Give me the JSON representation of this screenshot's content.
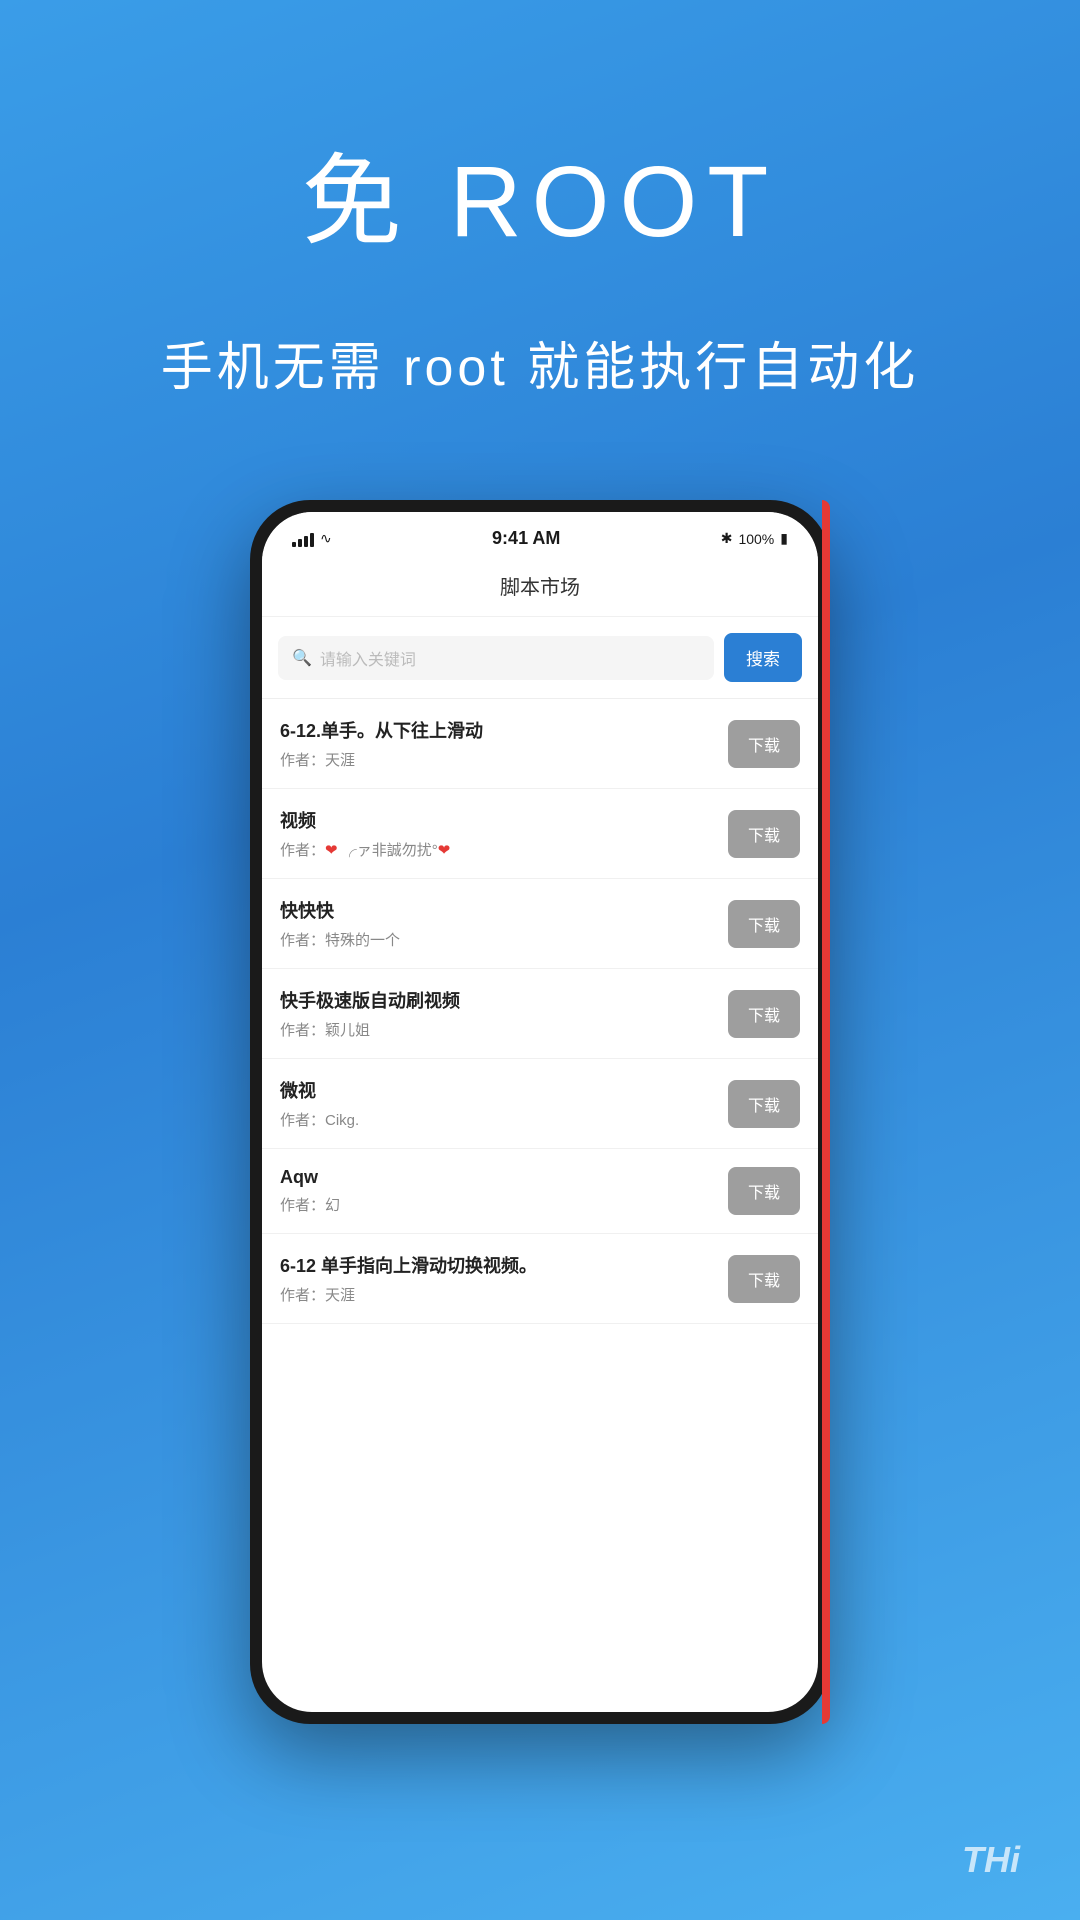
{
  "header": {
    "main_title": "免 ROOT",
    "sub_title": "手机无需 root 就能执行自动化"
  },
  "status_bar": {
    "time": "9:41 AM",
    "battery_percent": "100%",
    "bluetooth": "✱"
  },
  "app": {
    "title": "脚本市场",
    "search_placeholder": "请输入关键词",
    "search_button_label": "搜索"
  },
  "scripts": [
    {
      "name": "6-12.单手。从下往上滑动",
      "author": "作者：天涯",
      "download_label": "下载"
    },
    {
      "name": "视频",
      "author_prefix": "作者：",
      "author_special": "❤ ╭ァ非誠勿扰°❤",
      "download_label": "下载"
    },
    {
      "name": "快快快",
      "author": "作者：特殊的一个",
      "download_label": "下载"
    },
    {
      "name": "快手极速版自动刷视频",
      "author": "作者：颖儿姐",
      "download_label": "下载"
    },
    {
      "name": "微视",
      "author": "作者：Cikg.",
      "download_label": "下载"
    },
    {
      "name": "Aqw",
      "author": "作者：幻",
      "download_label": "下载"
    },
    {
      "name": "6-12 单手指向上滑动切换视频。",
      "author": "作者：天涯",
      "download_label": "下载"
    }
  ],
  "watermark": "THi"
}
